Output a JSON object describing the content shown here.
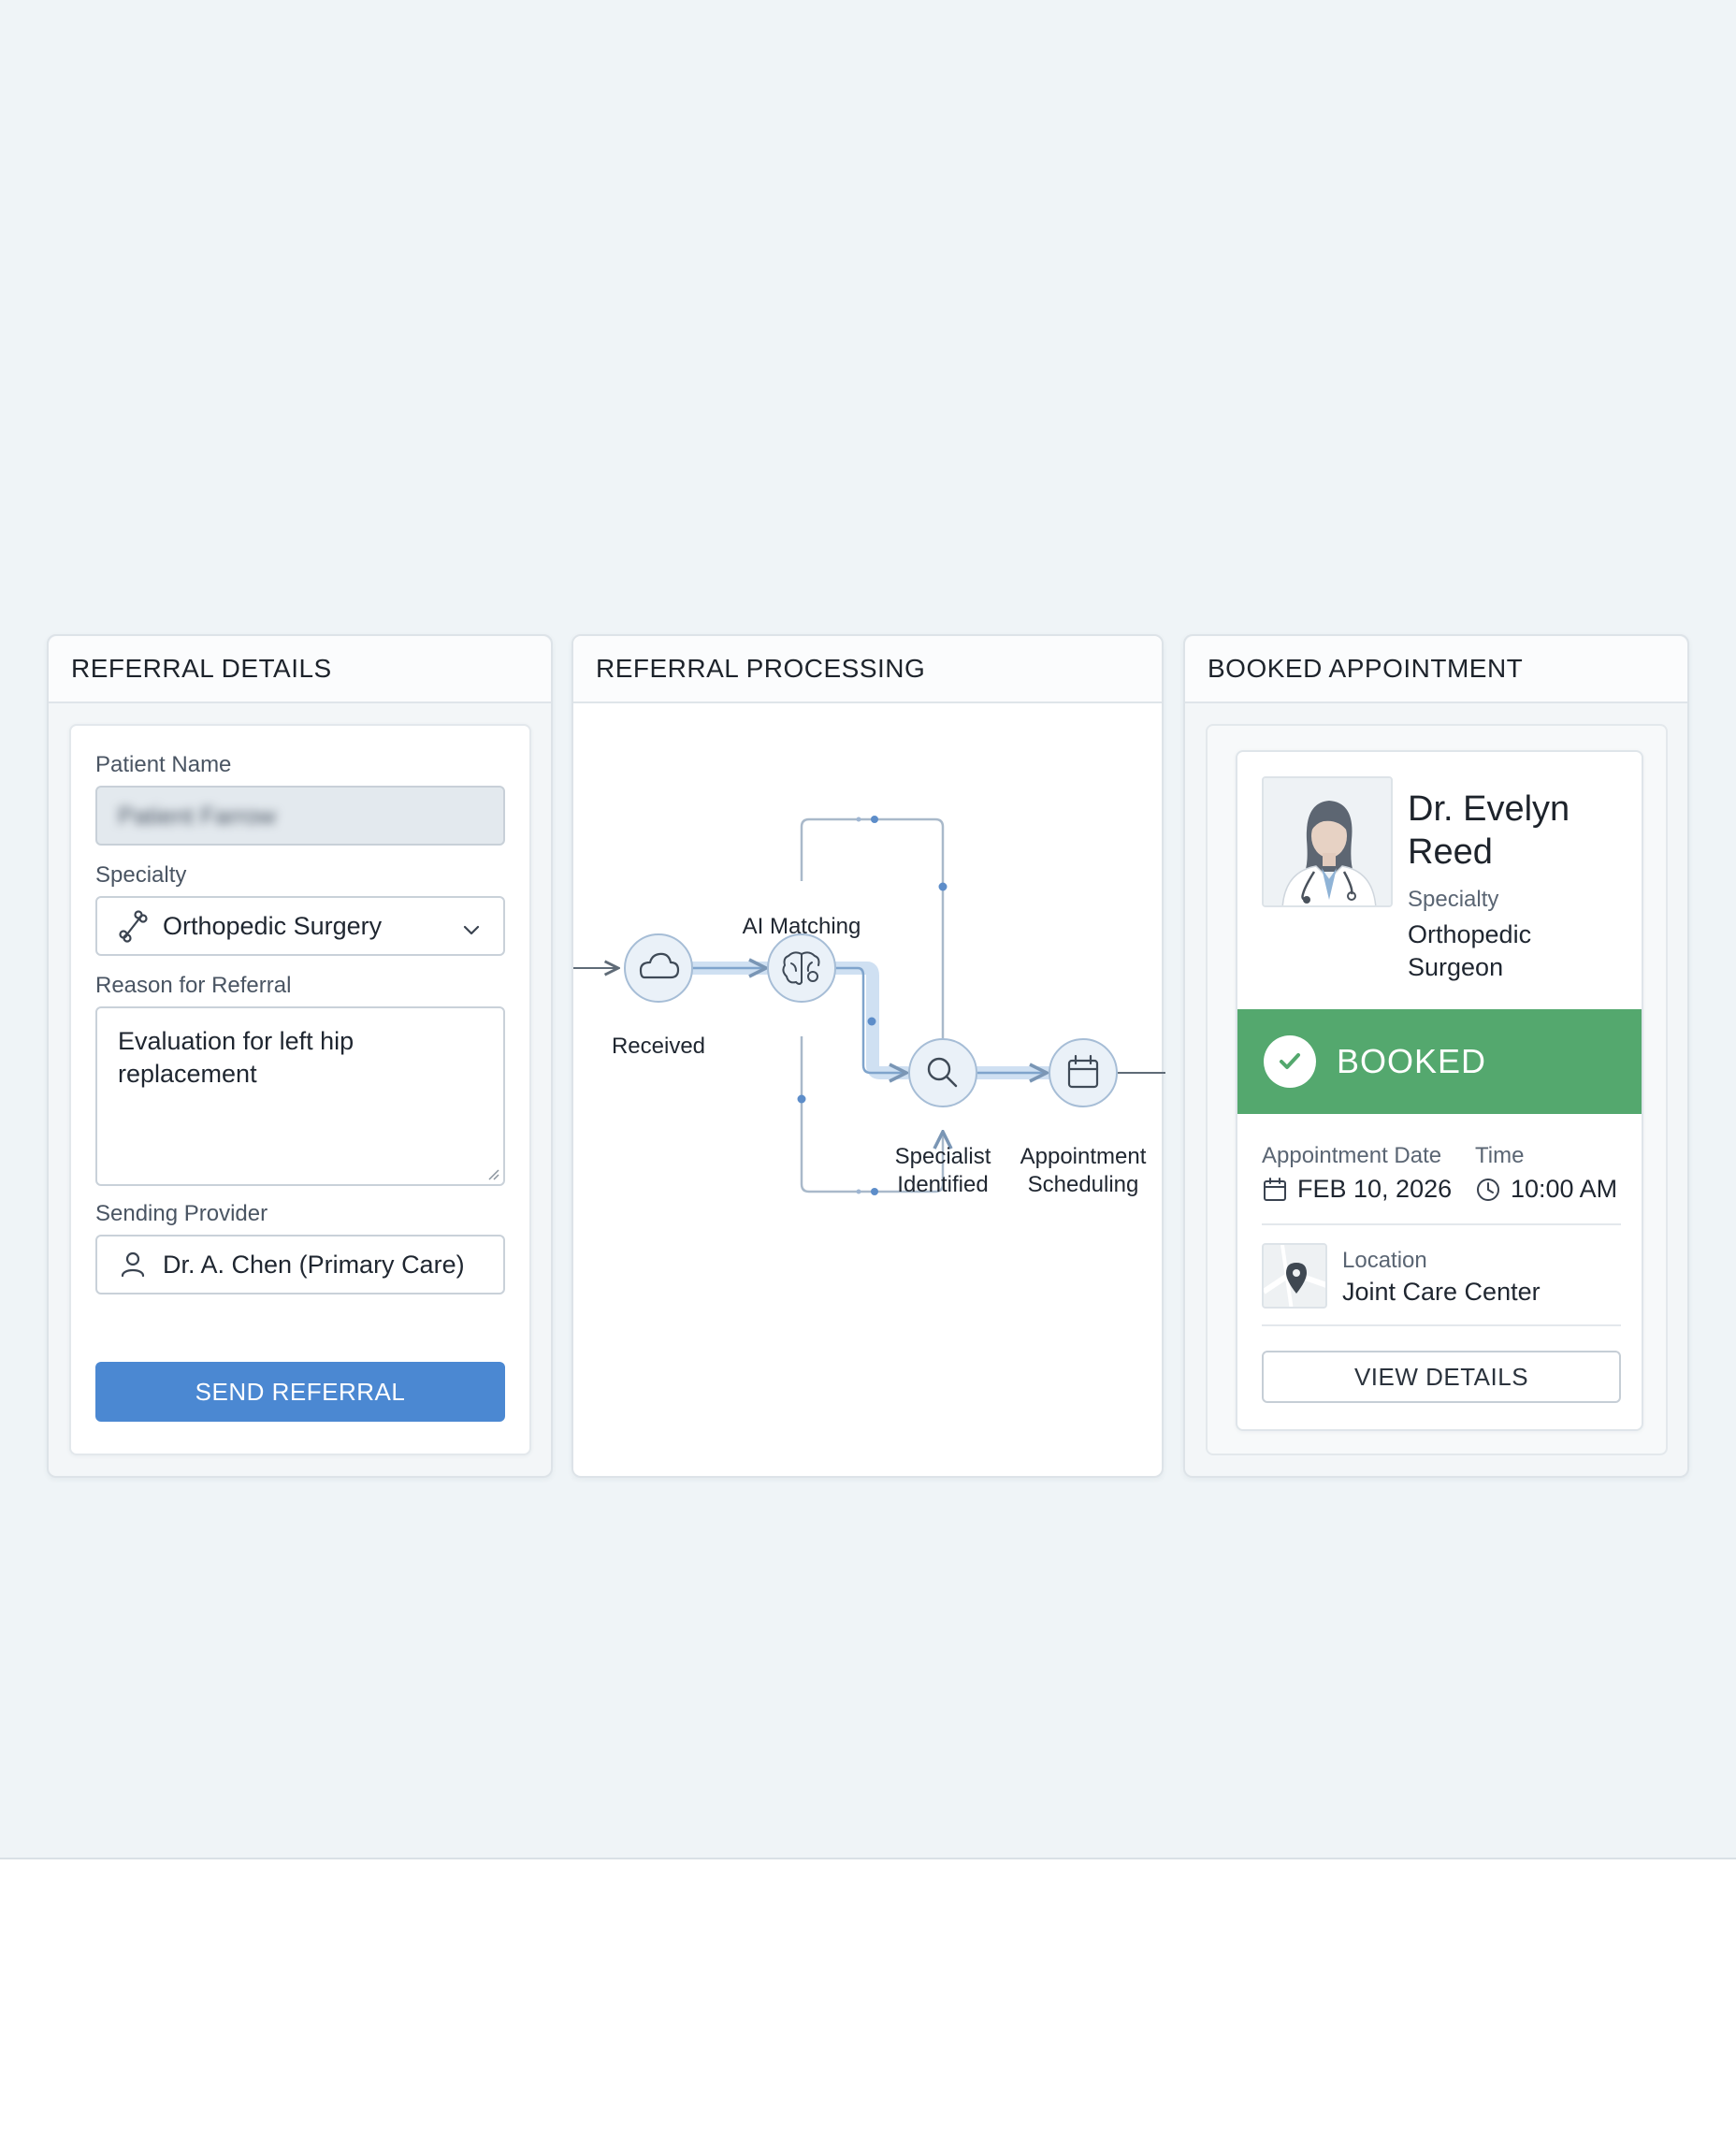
{
  "referral_details": {
    "title": "REFERRAL DETAILS",
    "patient_name_label": "Patient Name",
    "patient_name_value": "Patient Farrow",
    "specialty_label": "Specialty",
    "specialty_value": "Orthopedic Surgery",
    "reason_label": "Reason for Referral",
    "reason_value": "Evaluation for left hip replacement",
    "provider_label": "Sending Provider",
    "provider_value": "Dr. A. Chen (Primary Care)",
    "send_button": "SEND REFERRAL"
  },
  "referral_processing": {
    "title": "REFERRAL PROCESSING",
    "nodes": {
      "received": "Received",
      "ai_matching": "AI Matching",
      "specialist_line1": "Specialist",
      "specialist_line2": "Identified",
      "appointment_line1": "Appointment",
      "appointment_line2": "Scheduling"
    },
    "icons": [
      "cloud-icon",
      "brain-icon",
      "magnifier-icon",
      "calendar-icon"
    ]
  },
  "booked_appointment": {
    "title": "BOOKED APPOINTMENT",
    "doctor_name_line1": "Dr. Evelyn",
    "doctor_name_line2": "Reed",
    "specialty_label": "Specialty",
    "specialty_line1": "Orthopedic",
    "specialty_line2": "Surgeon",
    "status": "BOOKED",
    "date_label": "Appointment Date",
    "date_value": "FEB 10, 2026",
    "time_label": "Time",
    "time_value": "10:00 AM",
    "location_label": "Location",
    "location_value": "Joint Care Center",
    "view_button": "VIEW DETAILS"
  },
  "colors": {
    "primary_blue": "#4b88d2",
    "booked_green": "#54a86e",
    "page_background": "#eff4f7"
  }
}
